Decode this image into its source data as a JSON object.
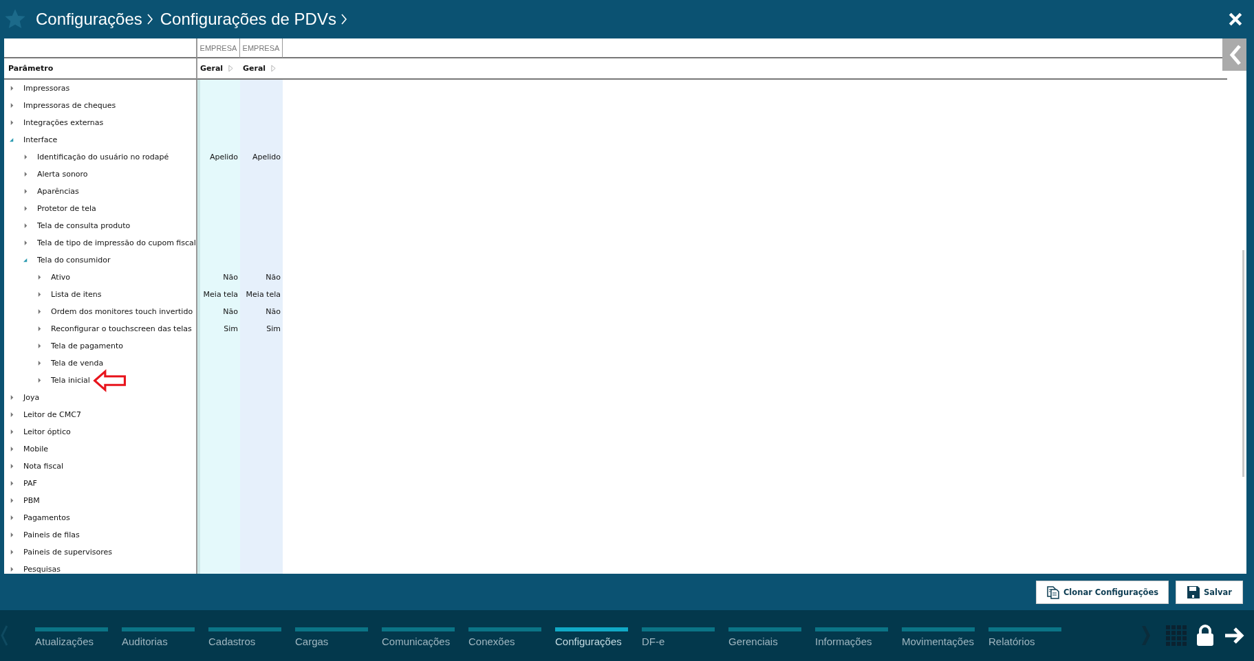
{
  "breadcrumb": [
    "Configurações",
    "Configurações de PDVs"
  ],
  "table": {
    "parameter_header": "Parâmetro",
    "columns": [
      {
        "group": "EMPRESA",
        "label": "Geral"
      },
      {
        "group": "EMPRESA",
        "label": "Geral"
      }
    ],
    "rows": [
      {
        "label": "Impressoras",
        "expanded": false
      },
      {
        "label": "Impressoras de cheques",
        "expanded": false
      },
      {
        "label": "Integrações externas",
        "expanded": false
      },
      {
        "label": "Interface",
        "expanded": true,
        "children": [
          {
            "label": "Identificação do usuário no rodapé",
            "expanded": false,
            "values": [
              "Apelido",
              "Apelido"
            ]
          },
          {
            "label": "Alerta sonoro",
            "expanded": false
          },
          {
            "label": "Aparências",
            "expanded": false
          },
          {
            "label": "Protetor de tela",
            "expanded": false
          },
          {
            "label": "Tela de consulta produto",
            "expanded": false
          },
          {
            "label": "Tela de tipo de impressão do cupom fiscal",
            "expanded": false
          },
          {
            "label": "Tela do consumidor",
            "expanded": true,
            "children": [
              {
                "label": "Ativo",
                "expanded": false,
                "values": [
                  "Não",
                  "Não"
                ]
              },
              {
                "label": "Lista de itens",
                "expanded": false,
                "values": [
                  "Meia tela",
                  "Meia tela"
                ]
              },
              {
                "label": "Ordem dos monitores touch invertido",
                "expanded": false,
                "values": [
                  "Não",
                  "Não"
                ]
              },
              {
                "label": "Reconfigurar o touchscreen das telas",
                "expanded": false,
                "values": [
                  "Sim",
                  "Sim"
                ]
              },
              {
                "label": "Tela de pagamento",
                "expanded": false
              },
              {
                "label": "Tela de venda",
                "expanded": false
              },
              {
                "label": "Tela inicial",
                "expanded": false,
                "marked": true
              }
            ]
          }
        ]
      },
      {
        "label": "Joya",
        "expanded": false
      },
      {
        "label": "Leitor de CMC7",
        "expanded": false
      },
      {
        "label": "Leitor óptico",
        "expanded": false
      },
      {
        "label": "Mobile",
        "expanded": false
      },
      {
        "label": "Nota fiscal",
        "expanded": false
      },
      {
        "label": "PAF",
        "expanded": false
      },
      {
        "label": "PBM",
        "expanded": false
      },
      {
        "label": "Pagamentos",
        "expanded": false
      },
      {
        "label": "Paineis de filas",
        "expanded": false
      },
      {
        "label": "Paineis de supervisores",
        "expanded": false
      },
      {
        "label": "Pesquisas",
        "expanded": false
      }
    ]
  },
  "actions": [
    "Clonar Configurações",
    "Salvar"
  ],
  "nav_tabs": [
    {
      "label": "Atualizações",
      "selected": false
    },
    {
      "label": "Auditorias",
      "selected": false
    },
    {
      "label": "Cadastros",
      "selected": false
    },
    {
      "label": "Cargas",
      "selected": false
    },
    {
      "label": "Comunicações",
      "selected": false
    },
    {
      "label": "Conexões",
      "selected": false
    },
    {
      "label": "Configurações",
      "selected": true
    },
    {
      "label": "DF-e",
      "selected": false
    },
    {
      "label": "Gerenciais",
      "selected": false
    },
    {
      "label": "Informações",
      "selected": false
    },
    {
      "label": "Movimentações",
      "selected": false
    },
    {
      "label": "Relatórios",
      "selected": false
    }
  ]
}
